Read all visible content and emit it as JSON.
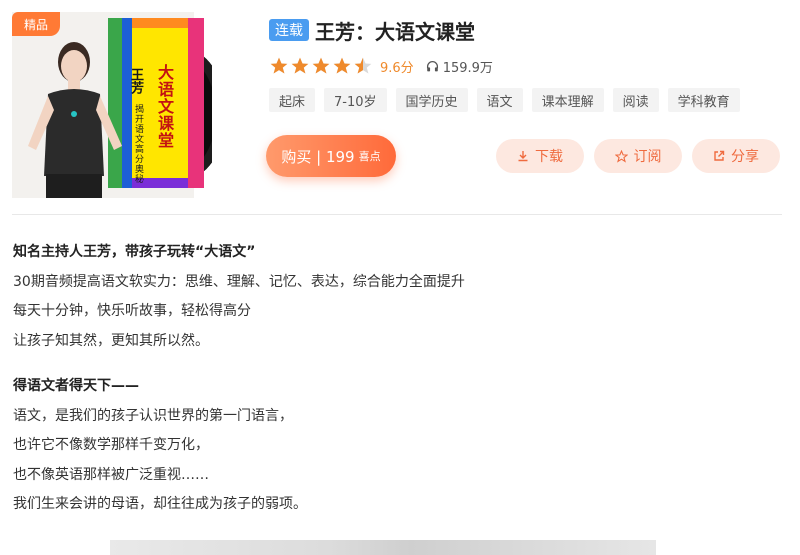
{
  "cover": {
    "badge": "精品",
    "title_vertical": "大语文课堂",
    "name_vertical": "王芳",
    "subtitle_vertical": "揭开语文高分奥秘"
  },
  "course": {
    "status_tag": "连载",
    "title": "王芳：大语文课堂",
    "rating": 4.5,
    "score_text": "9.6分",
    "plays": "159.9万",
    "tags": [
      "起床",
      "7-10岁",
      "国学历史",
      "语文",
      "课本理解",
      "阅读",
      "学科教育"
    ]
  },
  "actions": {
    "buy_label": "购买 | 199",
    "buy_unit": "喜点",
    "download": "下载",
    "subscribe": "订阅",
    "share": "分享"
  },
  "description": {
    "para1": [
      "知名主持人王芳，带孩子玩转“大语文”",
      "30期音频提高语文软实力：思维、理解、记忆、表达，综合能力全面提升",
      "每天十分钟，快乐听故事，轻松得高分",
      "让孩子知其然，更知其所以然。"
    ],
    "para2": [
      "得语文者得天下——",
      "语文，是我们的孩子认识世界的第一门语言，",
      "也许它不像数学那样千变万化，",
      "也不像英语那样被广泛重视……",
      "我们生来会讲的母语，却往往成为孩子的弱项。"
    ]
  },
  "colors": {
    "accent": "#ff6a3a",
    "star": "#ef8a2c",
    "serial_tag": "#4a9cf0",
    "secondary_bg": "#fde8e0"
  }
}
